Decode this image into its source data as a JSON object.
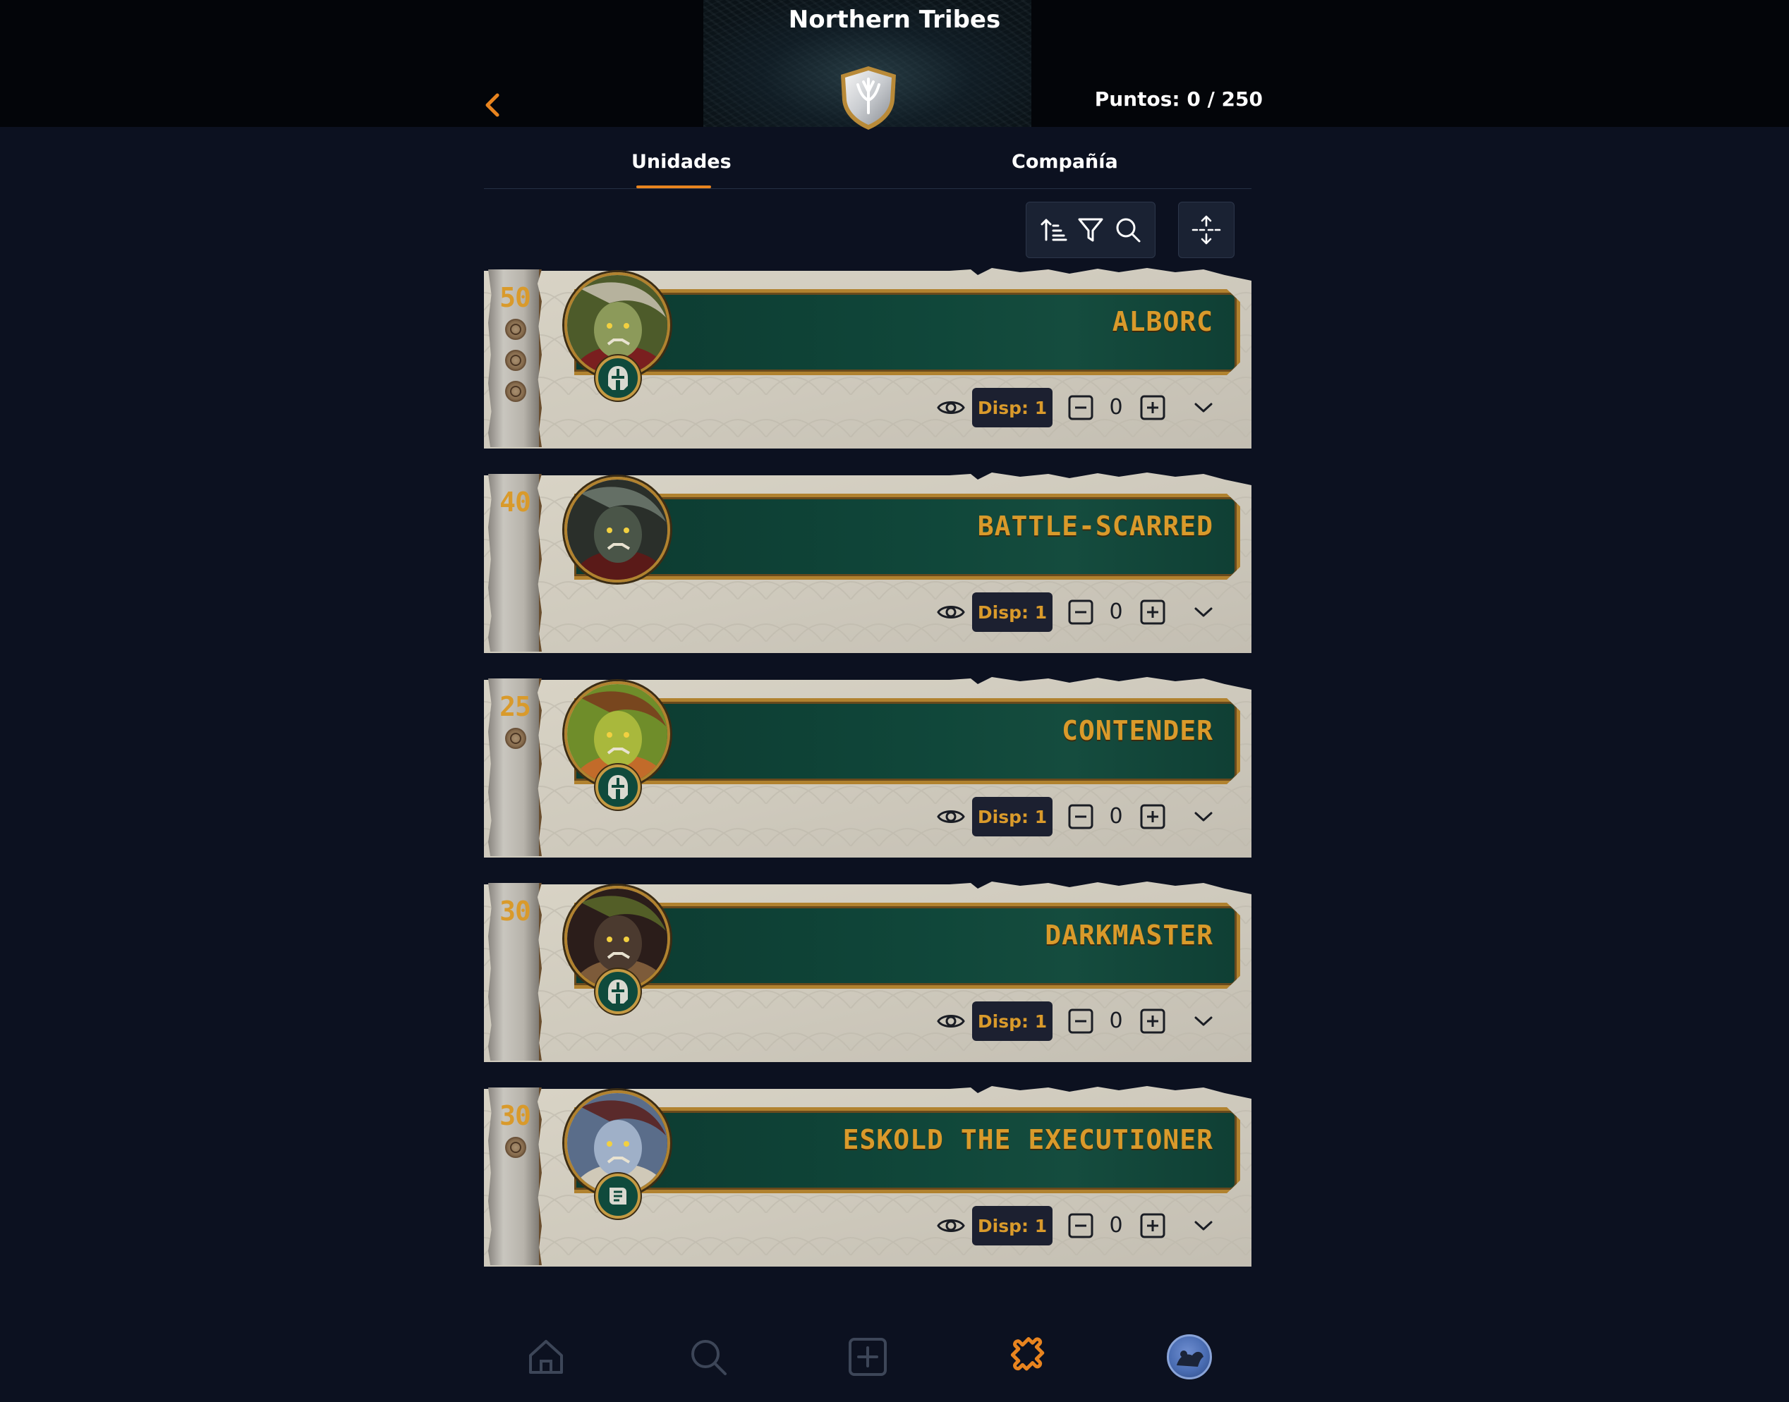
{
  "header": {
    "title": "Northern Tribes",
    "points": "Puntos: 0 / 250"
  },
  "tabs": [
    {
      "label": "Unidades",
      "active": true
    },
    {
      "label": "Compañía",
      "active": false
    }
  ],
  "colors": {
    "accent": "#e8841f",
    "gold_text": "#d99a2b",
    "banner_green": "#10473a",
    "background": "#0c1120"
  },
  "toolbar": {
    "icons": [
      "sort-icon",
      "filter-icon",
      "search-icon",
      "expand-collapse-icon"
    ]
  },
  "units": [
    {
      "cost": "50",
      "pips": 3,
      "name": "ALBORC",
      "role_icon": "helmet-icon",
      "disp": "Disp: 1",
      "quantity": "0"
    },
    {
      "cost": "40",
      "pips": 0,
      "name": "BATTLE-SCARRED",
      "role_icon": "",
      "disp": "Disp: 1",
      "quantity": "0"
    },
    {
      "cost": "25",
      "pips": 1,
      "name": "CONTENDER",
      "role_icon": "helmet-icon",
      "disp": "Disp: 1",
      "quantity": "0"
    },
    {
      "cost": "30",
      "pips": 0,
      "name": "DARKMASTER",
      "role_icon": "helmet-icon",
      "disp": "Disp: 1",
      "quantity": "0"
    },
    {
      "cost": "30",
      "pips": 1,
      "name": "ESKOLD THE EXECUTIONER",
      "role_icon": "scroll-icon",
      "disp": "Disp: 1",
      "quantity": "0"
    }
  ],
  "bottom_nav": {
    "items": [
      "home-icon",
      "search-icon",
      "add-icon",
      "puzzle-icon",
      "avatar"
    ],
    "active": "puzzle-icon"
  }
}
